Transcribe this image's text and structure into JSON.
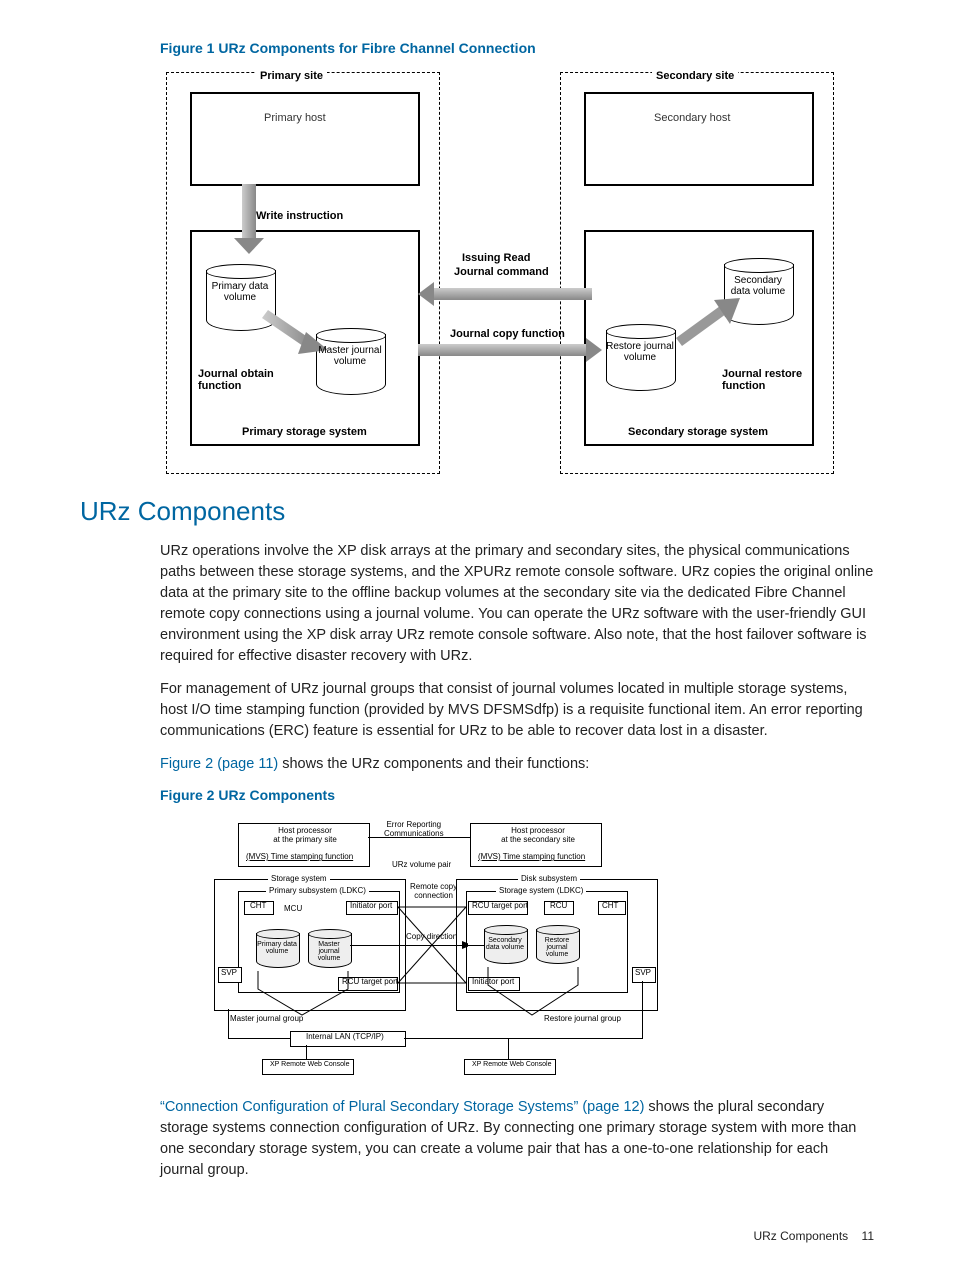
{
  "figure1": {
    "caption": "Figure 1 URz Components for Fibre Channel Connection",
    "primary_site": "Primary site",
    "secondary_site": "Secondary site",
    "primary_host": "Primary host",
    "secondary_host": "Secondary host",
    "write_instruction": "Write instruction",
    "issuing_read": "Issuing Read",
    "journal_command": "Journal command",
    "journal_copy": "Journal copy function",
    "journal_obtain": "Journal obtain\nfunction",
    "journal_restore": "Journal restore\nfunction",
    "primary_storage": "Primary storage system",
    "secondary_storage": "Secondary storage system",
    "prim_data_vol": "Primary\ndata\nvolume",
    "sec_data_vol": "Secondary\ndata\nvolume",
    "master_jnl": "Master\njournal\nvolume",
    "restore_jnl": "Restore\njournal\nvolume"
  },
  "heading": "URz Components",
  "para1": "URz operations involve the XP disk arrays at the primary and secondary sites, the physical communications paths between these storage systems, and the XPURz remote console software. URz copies the original online data at the primary site to the offline backup volumes at the secondary site via the dedicated Fibre Channel remote copy connections using a journal volume. You can operate the URz software with the user-friendly GUI environment using the XP disk array URz remote console software. Also note, that the host failover software is required for effective disaster recovery with URz.",
  "para2": "For management of URz journal groups that consist of journal volumes located in multiple storage systems, host I/O time stamping function (provided by MVS DFSMSdfp) is a requisite functional item. An error reporting communications (ERC) feature is essential for URz to be able to recover data lost in a disaster.",
  "para3_link": "Figure 2 (page 11)",
  "para3_rest": " shows the URz components and their functions:",
  "figure2": {
    "caption": "Figure 2 URz Components",
    "host_primary": "Host processor\nat the primary site",
    "host_secondary": "Host processor\nat the secondary site",
    "mvs_time": "(MVS) Time stamping function",
    "erc": "Error Reporting\nCommunications",
    "urz_pair": "URz volume pair",
    "storage_system": "Storage system",
    "disk_subsystem": "Disk subsystem",
    "primary_subsystem": "Primary subsystem (LDKC)",
    "storage_ldkc": "Storage system (LDKC)",
    "remote_copy": "Remote copy\nconnection",
    "copy_direction": "Copy direction",
    "cht": "CHT",
    "mcu": "MCU",
    "rcu": "RCU",
    "initiator": "Initiator port",
    "rcu_target": "RCU target port",
    "svp": "SVP",
    "prim_data": "Primary\ndata\nvolume",
    "master_jnl": "Master\njournal\nvolume",
    "sec_data": "Secondary\ndata\nvolume",
    "restore_jnl": "Restore\njournal\nvolume",
    "master_group": "Master journal group",
    "restore_group": "Restore journal group",
    "internal_lan": "Internal LAN (TCP/IP)",
    "xp_console": "XP Remote Web Console"
  },
  "para4_link": "“Connection Configuration of Plural Secondary Storage Systems” (page 12)",
  "para4_rest": " shows the plural secondary storage systems connection configuration of URz. By connecting one primary storage system with more than one secondary storage system, you can create a volume pair that has a one-to-one relationship for each journal group.",
  "footer_label": "URz Components",
  "footer_page": "11"
}
